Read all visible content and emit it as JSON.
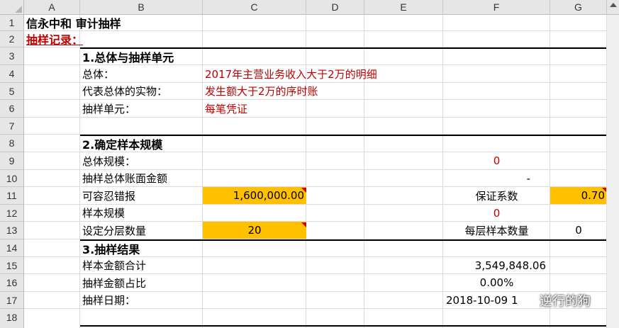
{
  "columns": [
    "A",
    "B",
    "C",
    "D",
    "E",
    "F",
    "G"
  ],
  "rows": [
    "1",
    "2",
    "3",
    "4",
    "5",
    "6",
    "7",
    "8",
    "9",
    "10",
    "11",
    "12",
    "13",
    "14",
    "15",
    "16",
    "17",
    "18"
  ],
  "cells": {
    "a1": "信永中和  审计抽样",
    "a2": "抽样记录：",
    "b3": "1.总体与抽样单元",
    "b4": "总体：",
    "c4": "2017年主营业务收入大于2万的明细",
    "b5": "代表总体的实物：",
    "c5": "发生额大于2万的序时账",
    "b6": "抽样单元：",
    "c6": "每笔凭证",
    "b8": "2.确定样本规模",
    "b9": "总体规模：",
    "f9": "0",
    "b10": "抽样总体账面金额",
    "f10": "-",
    "b11": "可容忍错报",
    "c11": "1,600,000.00",
    "f11": "保证系数",
    "g11": "0.70",
    "b12": "样本规模",
    "f12": "0",
    "b13": "设定分层数量",
    "c13": "20",
    "f13": "每层样本数量",
    "g13": "0",
    "b14": "3.抽样结果",
    "b15": "样本金额合计",
    "f15": "3,549,848.06",
    "b16": "抽样金额占比",
    "f16": "0.00%",
    "b17": "抽样日期：",
    "f17": "2018-10-09 1"
  },
  "watermark": {
    "text": "逆行的狗",
    "icon": "wechat-icon"
  },
  "colors": {
    "highlight": "#ffc000",
    "red_text": "#c00000",
    "header_bg": "#e6e6e6"
  }
}
